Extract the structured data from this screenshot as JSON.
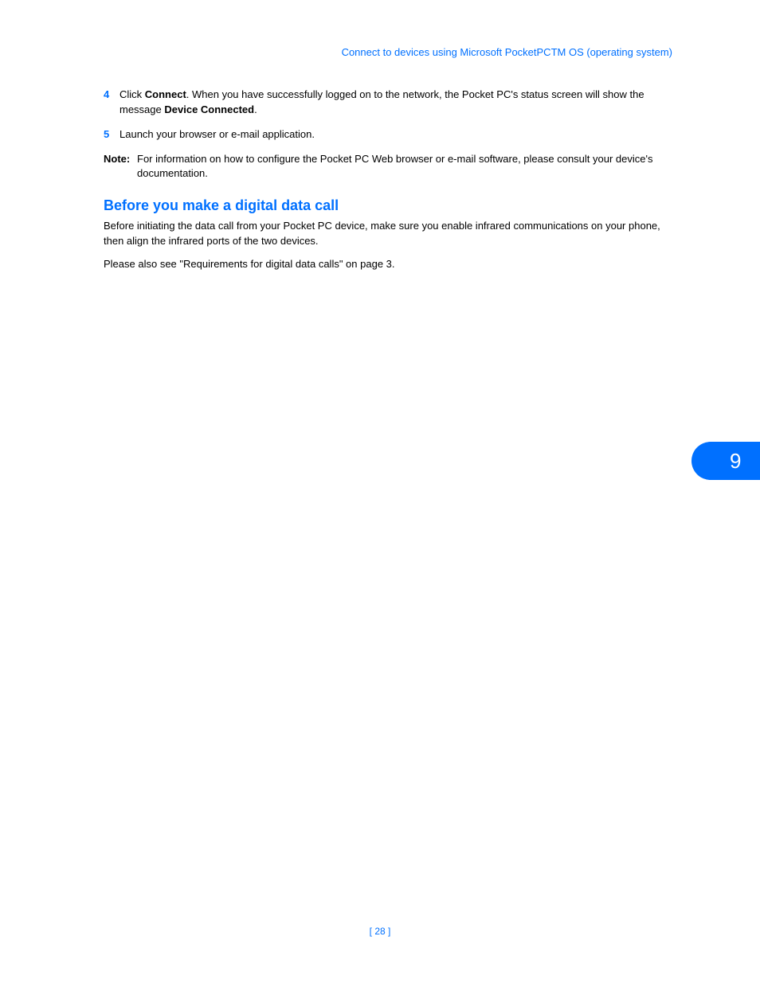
{
  "header": {
    "title": "Connect to devices using Microsoft PocketPCTM OS (operating system)"
  },
  "steps": [
    {
      "number": "4",
      "pre": "Click ",
      "bold1": "Connect",
      "mid": ". When you have successfully logged on to the network, the Pocket PC's status screen will show the message ",
      "bold2": "Device Connected",
      "post": "."
    },
    {
      "number": "5",
      "text": "Launch your browser or e-mail application."
    }
  ],
  "note": {
    "label": "Note:",
    "text": "For information on how to configure the Pocket PC Web browser or e-mail software, please consult your device's documentation."
  },
  "section": {
    "heading": "Before you make a digital data call",
    "para1": "Before initiating the data call from your Pocket PC device, make sure you enable infrared communications on your phone, then align the infrared ports of the two devices.",
    "para2": "Please also see \"Requirements for digital data calls\" on page 3."
  },
  "sideTab": "9",
  "footer": "[ 28 ]"
}
